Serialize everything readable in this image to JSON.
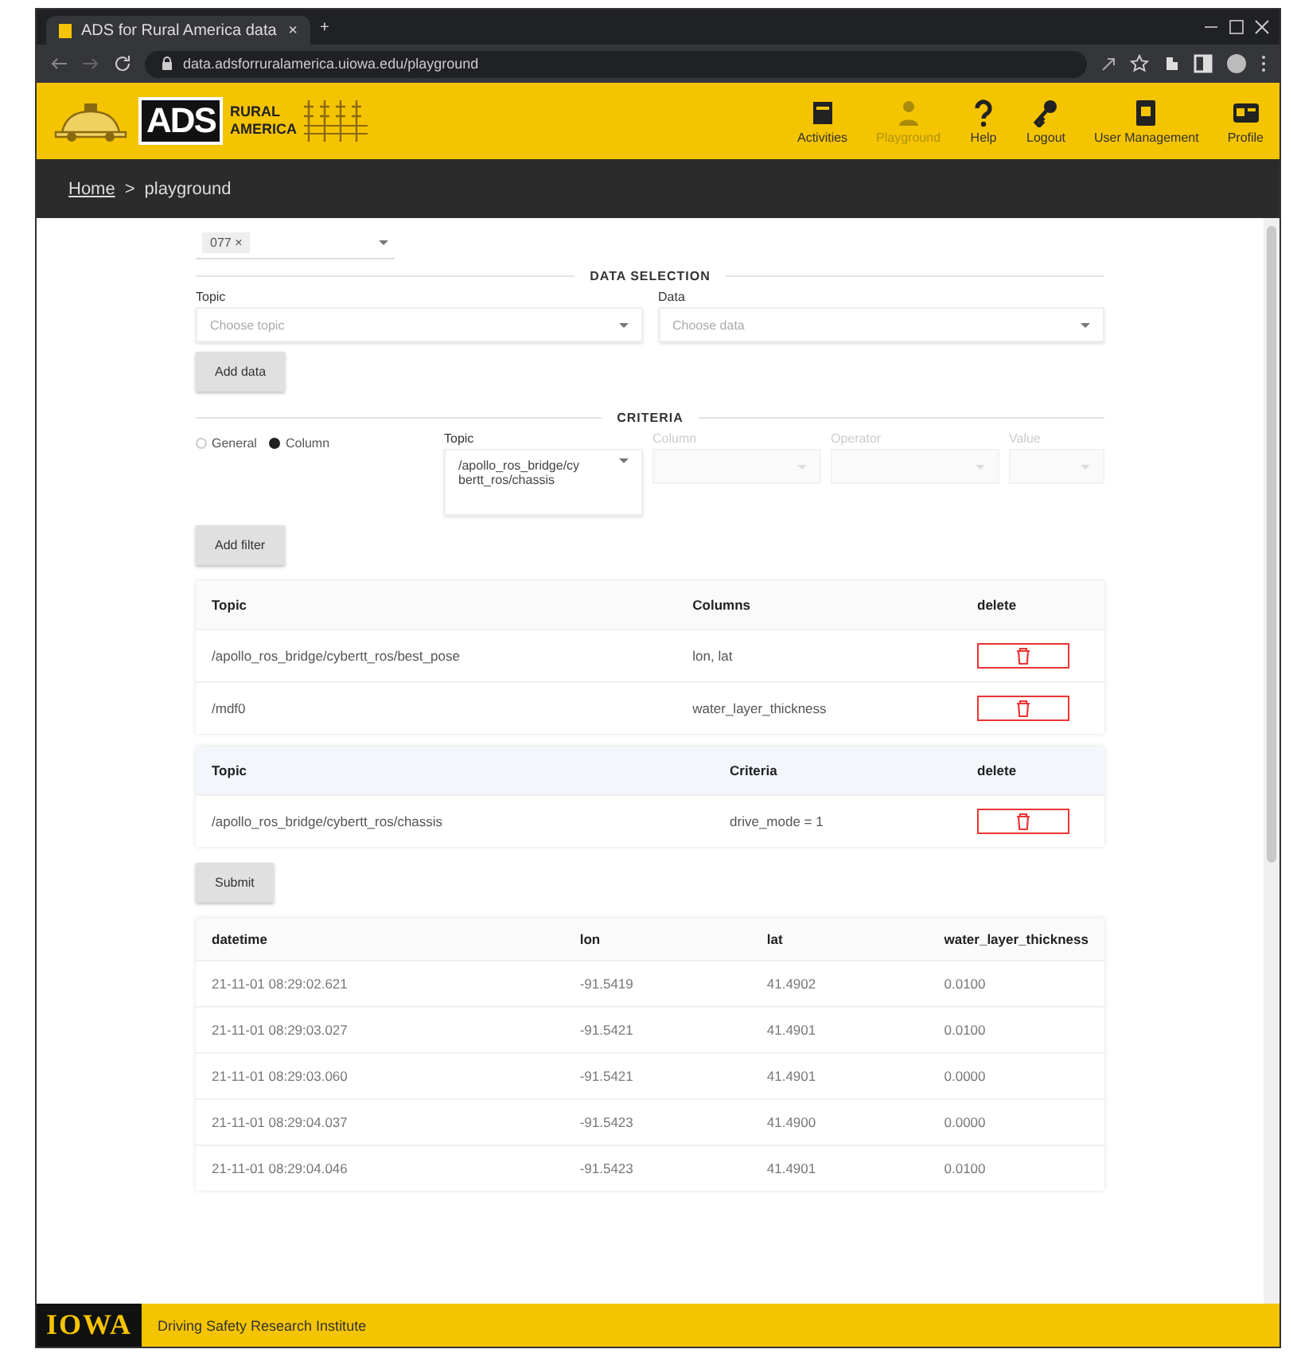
{
  "browser": {
    "tab_title": "ADS for Rural America data",
    "tab_close": "×",
    "new_tab": "+",
    "url": "data.adsforruralamerica.uiowa.edu/playground"
  },
  "header": {
    "logo": {
      "main": "ADS",
      "line1": "RURAL",
      "line2": "AMERICA"
    },
    "nav": [
      {
        "label": "Activities",
        "disabled": false
      },
      {
        "label": "Playground",
        "disabled": true
      },
      {
        "label": "Help",
        "disabled": false
      },
      {
        "label": "Logout",
        "disabled": false
      },
      {
        "label": "User Management",
        "disabled": false
      },
      {
        "label": "Profile",
        "disabled": false
      }
    ]
  },
  "breadcrumb": {
    "items": [
      "Home",
      "playground"
    ],
    "separator": ">"
  },
  "vehicle_select": {
    "chip": "077",
    "chip_remove": "×"
  },
  "data_selection": {
    "heading": "DATA SELECTION",
    "fields": [
      {
        "label": "Topic",
        "placeholder": "Choose topic"
      },
      {
        "label": "Data",
        "placeholder": "Choose data"
      }
    ],
    "button": "Add data"
  },
  "criteria": {
    "heading": "CRITERIA",
    "radios": [
      {
        "label": "General",
        "selected": false
      },
      {
        "label": "Column",
        "selected": true
      }
    ],
    "fields": [
      {
        "label": "Topic",
        "value": "/apollo_ros_bridge/cybertt_ros/chassis",
        "disabled": false
      },
      {
        "label": "Column",
        "disabled": true
      },
      {
        "label": "Operator",
        "disabled": true
      },
      {
        "label": "Value",
        "disabled": true
      }
    ],
    "button": "Add filter"
  },
  "data_table": {
    "columns": [
      "Topic",
      "Columns",
      "delete"
    ],
    "rows": [
      [
        "/apollo_ros_bridge/cybertt_ros/best_pose",
        "lon, lat"
      ],
      [
        "/mdf0",
        "water_layer_thickness"
      ]
    ]
  },
  "criteria_table": {
    "columns": [
      "Topic",
      "Criteria",
      "delete"
    ],
    "rows": [
      [
        "/apollo_ros_bridge/cybertt_ros/chassis",
        "drive_mode = 1"
      ]
    ]
  },
  "submit": "Submit",
  "results": {
    "columns": [
      "datetime",
      "lon",
      "lat",
      "water_layer_thickness"
    ],
    "rows": [
      [
        "21-11-01 08:29:02.621",
        "-91.5419",
        "41.4902",
        "0.0100"
      ],
      [
        "21-11-01 08:29:03.027",
        "-91.5421",
        "41.4901",
        "0.0100"
      ],
      [
        "21-11-01 08:29:03.060",
        "-91.5421",
        "41.4901",
        "0.0000"
      ],
      [
        "21-11-01 08:29:04.037",
        "-91.5423",
        "41.4900",
        "0.0000"
      ],
      [
        "21-11-01 08:29:04.046",
        "-91.5423",
        "41.4901",
        "0.0100"
      ]
    ]
  },
  "footer": {
    "logo": "IOWA",
    "text": "Driving Safety Research Institute"
  }
}
